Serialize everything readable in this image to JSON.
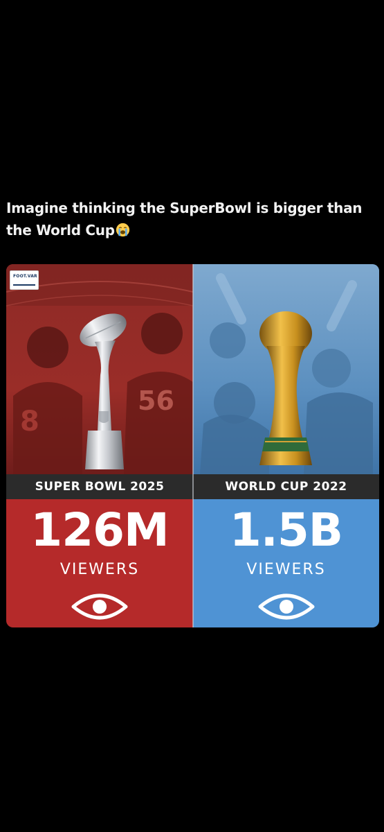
{
  "post": {
    "text": "Imagine thinking the SuperBowl is bigger than the World Cup",
    "emoji": "loudly-crying-face-emoji"
  },
  "graphic": {
    "logo_text": "FOOT.VAR",
    "left": {
      "title": "SUPER BOWL 2025",
      "value": "126M",
      "unit": "VIEWERS",
      "color": "#b52a2a",
      "trophy": "lombardi-trophy"
    },
    "right": {
      "title": "WORLD CUP 2022",
      "value": "1.5B",
      "unit": "VIEWERS",
      "color": "#4f93d4",
      "trophy": "world-cup-trophy"
    }
  }
}
